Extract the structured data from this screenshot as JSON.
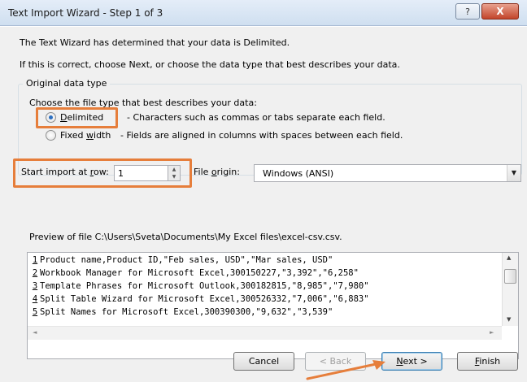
{
  "window": {
    "title": "Text Import Wizard - Step 1 of 3",
    "help_label": "?",
    "close_label": "X"
  },
  "intro": {
    "line1": "The Text Wizard has determined that your data is Delimited.",
    "line2": "If this is correct, choose Next, or choose the data type that best describes your data."
  },
  "data_type_group": {
    "legend": "Original data type",
    "prompt": "Choose the file type that best describes your data:",
    "options": [
      {
        "label_pre": "",
        "label_ul": "D",
        "label_post": "elimited",
        "description": "- Characters such as commas or tabs separate each field.",
        "selected": true
      },
      {
        "label_pre": "Fixed ",
        "label_ul": "w",
        "label_post": "idth",
        "description": "- Fields are aligned in columns with spaces between each field.",
        "selected": false
      }
    ]
  },
  "start_import": {
    "label_pre": "Start import at ",
    "label_ul": "r",
    "label_post": "ow:",
    "value": "1",
    "up_glyph": "▲",
    "down_glyph": "▼"
  },
  "file_origin": {
    "label_pre": "File ",
    "label_ul": "o",
    "label_post": "rigin:",
    "value": "Windows (ANSI)",
    "arrow_glyph": "▼"
  },
  "preview": {
    "label": "Preview of file C:\\Users\\Sveta\\Documents\\My Excel files\\excel-csv.csv.",
    "rows": [
      {
        "num": "1",
        "text": "Product name,Product ID,\"Feb sales, USD\",\"Mar sales, USD\""
      },
      {
        "num": "2",
        "text": "Workbook Manager for Microsoft Excel,300150227,\"3,392\",\"6,258\""
      },
      {
        "num": "3",
        "text": "Template Phrases for Microsoft Outlook,300182815,\"8,985\",\"7,980\""
      },
      {
        "num": "4",
        "text": "Split Table Wizard for Microsoft Excel,300526332,\"7,006\",\"6,883\""
      },
      {
        "num": "5",
        "text": "Split Names for Microsoft Excel,300390300,\"9,632\",\"3,539\""
      }
    ],
    "scroll_up_glyph": "▲",
    "scroll_down_glyph": "▼",
    "scroll_left_glyph": "◄",
    "scroll_right_glyph": "►"
  },
  "buttons": {
    "cancel": "Cancel",
    "back": "< Back",
    "next_pre": "",
    "next_ul": "N",
    "next_post": "ext >",
    "finish_pre": "",
    "finish_ul": "F",
    "finish_post": "inish"
  },
  "colors": {
    "highlight": "#e67e3b",
    "close_button": "#c3452b"
  }
}
